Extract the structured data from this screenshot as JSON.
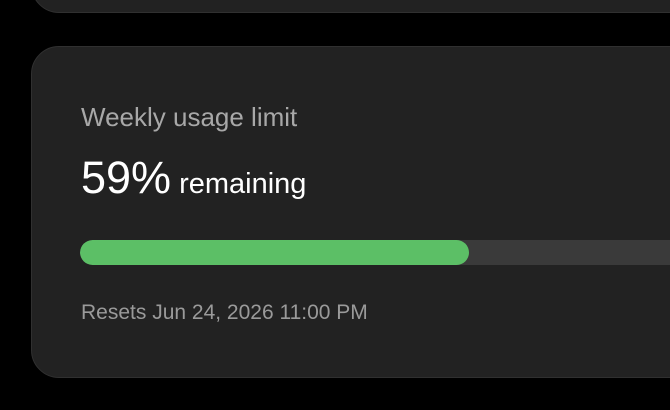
{
  "weekly_limit": {
    "title": "Weekly usage limit",
    "percent_text": "59%",
    "remaining_label": "remaining",
    "remaining_fraction": 0.59,
    "reset_text": "Resets Jun 24, 2026 11:00 PM"
  },
  "colors": {
    "background": "#000000",
    "card": "#222222",
    "progress_fill": "#5cbf66",
    "title_text": "#a8a8a8",
    "value_text": "#ffffff"
  }
}
